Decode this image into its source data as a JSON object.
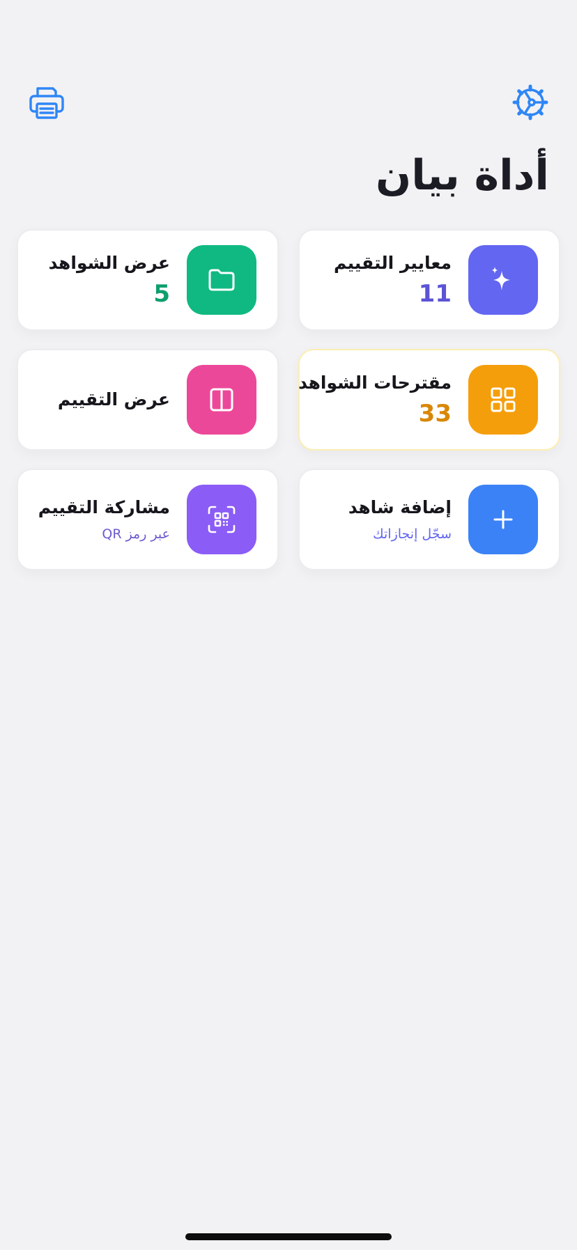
{
  "header": {
    "title": "أداة بيان",
    "print_icon": "printer-icon",
    "settings_icon": "gear-icon"
  },
  "colors": {
    "accent": "#2f86f6",
    "indigo": "#6366f1",
    "green": "#10b981",
    "amber": "#f59e0b",
    "pink": "#ec4899",
    "purple": "#8b5cf6",
    "blue": "#3b82f6"
  },
  "cards": [
    {
      "title": "معايير التقييم",
      "value": "11",
      "icon": "sparkles-icon"
    },
    {
      "title": "عرض الشواهد",
      "value": "5",
      "icon": "folder-icon"
    },
    {
      "title": "مقترحات الشواهد",
      "value": "33",
      "icon": "grid-icon"
    },
    {
      "title": "عرض التقييم",
      "icon": "columns-icon"
    },
    {
      "title": "إضافة شاهد",
      "subtitle": "سجّل إنجازاتك",
      "icon": "plus-icon"
    },
    {
      "title": "مشاركة التقييم",
      "subtitle": "عبر رمز QR",
      "icon": "qr-code-icon"
    }
  ]
}
